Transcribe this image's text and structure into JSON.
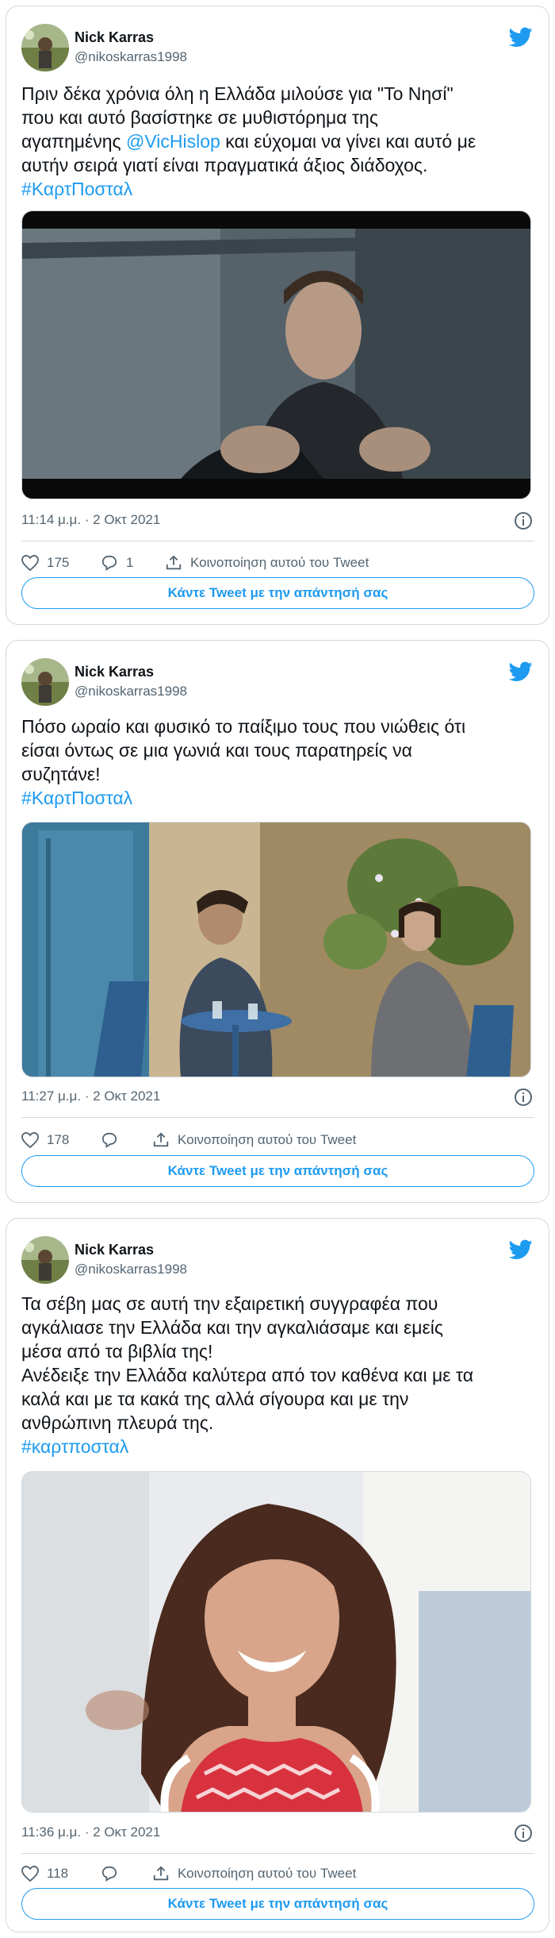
{
  "tweets": [
    {
      "author_name": "Nick Karras",
      "author_handle": "@nikoskarras1998",
      "text_lines": [
        {
          "parts": [
            {
              "t": "Πριν δέκα χρόνια όλη η Ελλάδα μιλούσε για \"Το Νησί\""
            }
          ]
        },
        {
          "parts": [
            {
              "t": "που και αυτό βασίστηκε σε μυθιστόρημα της"
            }
          ]
        },
        {
          "parts": [
            {
              "t": "αγαπημένης "
            },
            {
              "t": "@VicHislop",
              "link": true
            },
            {
              "t": " και εύχομαι να γίνει και αυτό με"
            }
          ]
        },
        {
          "parts": [
            {
              "t": "αυτήν σειρά γιατί είναι πραγματικά άξιος διάδοχος."
            }
          ]
        },
        {
          "parts": [
            {
              "t": " #ΚαρτΠοσταλ",
              "link": true
            }
          ]
        }
      ],
      "timestamp": "11:14 μ.μ. · 2 Οκτ 2021",
      "likes": "175",
      "replies": "1",
      "share_label": "Κοινοποίηση αυτού του Tweet",
      "reply_button": "Κάντε Tweet με την απάντησή σας",
      "media_icon": "video-still-man-driving"
    },
    {
      "author_name": "Nick Karras",
      "author_handle": "@nikoskarras1998",
      "text_lines": [
        {
          "parts": [
            {
              "t": "Πόσο ωραίο και φυσικό το παίξιμο τους που νιώθεις ότι"
            }
          ]
        },
        {
          "parts": [
            {
              "t": "είσαι όντως σε μια γωνιά και τους παρατηρείς να"
            }
          ]
        },
        {
          "parts": [
            {
              "t": "συζητάνε!"
            }
          ]
        },
        {
          "parts": [
            {
              "t": "#ΚαρτΠοσταλ",
              "link": true
            }
          ]
        }
      ],
      "timestamp": "11:27 μ.μ. · 2 Οκτ 2021",
      "likes": "178",
      "replies": "",
      "share_label": "Κοινοποίηση αυτού του Tweet",
      "reply_button": "Κάντε Tweet με την απάντησή σας",
      "media_icon": "photo-two-men-cafe"
    },
    {
      "author_name": "Nick Karras",
      "author_handle": "@nikoskarras1998",
      "text_lines": [
        {
          "parts": [
            {
              "t": "Τα σέβη μας σε αυτή την εξαιρετική συγγραφέα που"
            }
          ]
        },
        {
          "parts": [
            {
              "t": "αγκάλιασε την Ελλάδα και την αγκαλιάσαμε και εμείς"
            }
          ]
        },
        {
          "parts": [
            {
              "t": "μέσα από τα βιβλία της!"
            }
          ]
        },
        {
          "parts": [
            {
              "t": "Ανέδειξε την Ελλάδα καλύτερα από τον καθένα και με τα"
            }
          ]
        },
        {
          "parts": [
            {
              "t": "καλά και με τα κακά της αλλά σίγουρα και με την"
            }
          ]
        },
        {
          "parts": [
            {
              "t": "ανθρώπινη πλευρά της."
            }
          ]
        },
        {
          "parts": [
            {
              "t": "#καρτποσταλ",
              "link": true
            }
          ]
        }
      ],
      "timestamp": "11:36 μ.μ. · 2 Οκτ 2021",
      "likes": "118",
      "replies": "",
      "share_label": "Κοινοποίηση αυτού του Tweet",
      "reply_button": "Κάντε Tweet με την απάντησή σας",
      "media_icon": "photo-woman-portrait"
    }
  ],
  "colors": {
    "accent": "#1d9bf0",
    "muted": "#536471",
    "border": "#cfd9de"
  }
}
